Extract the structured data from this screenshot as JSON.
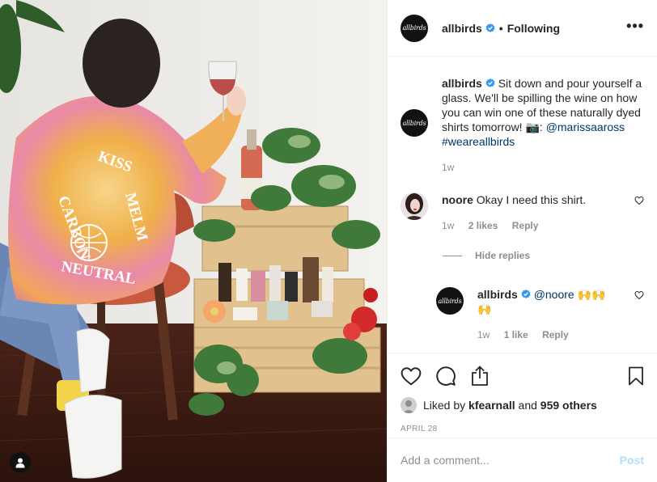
{
  "post": {
    "author": "allbirds",
    "follow_state": "Following",
    "separator": "•",
    "more": "•••",
    "avatar_text": "allbirds",
    "caption": {
      "author": "allbirds",
      "text": "Sit down and pour yourself a glass. We'll be spilling the wine on how you can win one of these naturally dyed shirts tomorrow! 📷:",
      "mention": "@marissaaross",
      "hashtag": "#weareallbirds",
      "age": "1w"
    },
    "comments": [
      {
        "author": "noore",
        "text": "Okay I need this shirt.",
        "age": "1w",
        "likes": "2 likes",
        "reply": "Reply"
      }
    ],
    "hide_replies": "Hide replies",
    "replies": [
      {
        "author": "allbirds",
        "mention": "@noore",
        "emoji": "🙌🙌🙌",
        "age": "1w",
        "likes": "1 like",
        "reply": "Reply"
      }
    ],
    "liked_by_prefix": "Liked by",
    "liked_by_user": "kfearnall",
    "liked_by_and": "and",
    "liked_by_others": "959 others",
    "date": "APRIL 28",
    "add_comment_placeholder": "Add a comment...",
    "post_button": "Post",
    "photo_shirt_text": [
      "KISS",
      "MELM",
      "CARBON",
      "NEUTRAL"
    ]
  },
  "colors": {
    "verified": "#3897f0",
    "link": "#003569",
    "muted": "#8e8e8e",
    "post_disabled": "#b2dffc"
  },
  "icons": [
    "heart-icon",
    "comment-icon",
    "share-icon",
    "bookmark-icon",
    "verified-badge-icon",
    "user-tag-icon"
  ]
}
